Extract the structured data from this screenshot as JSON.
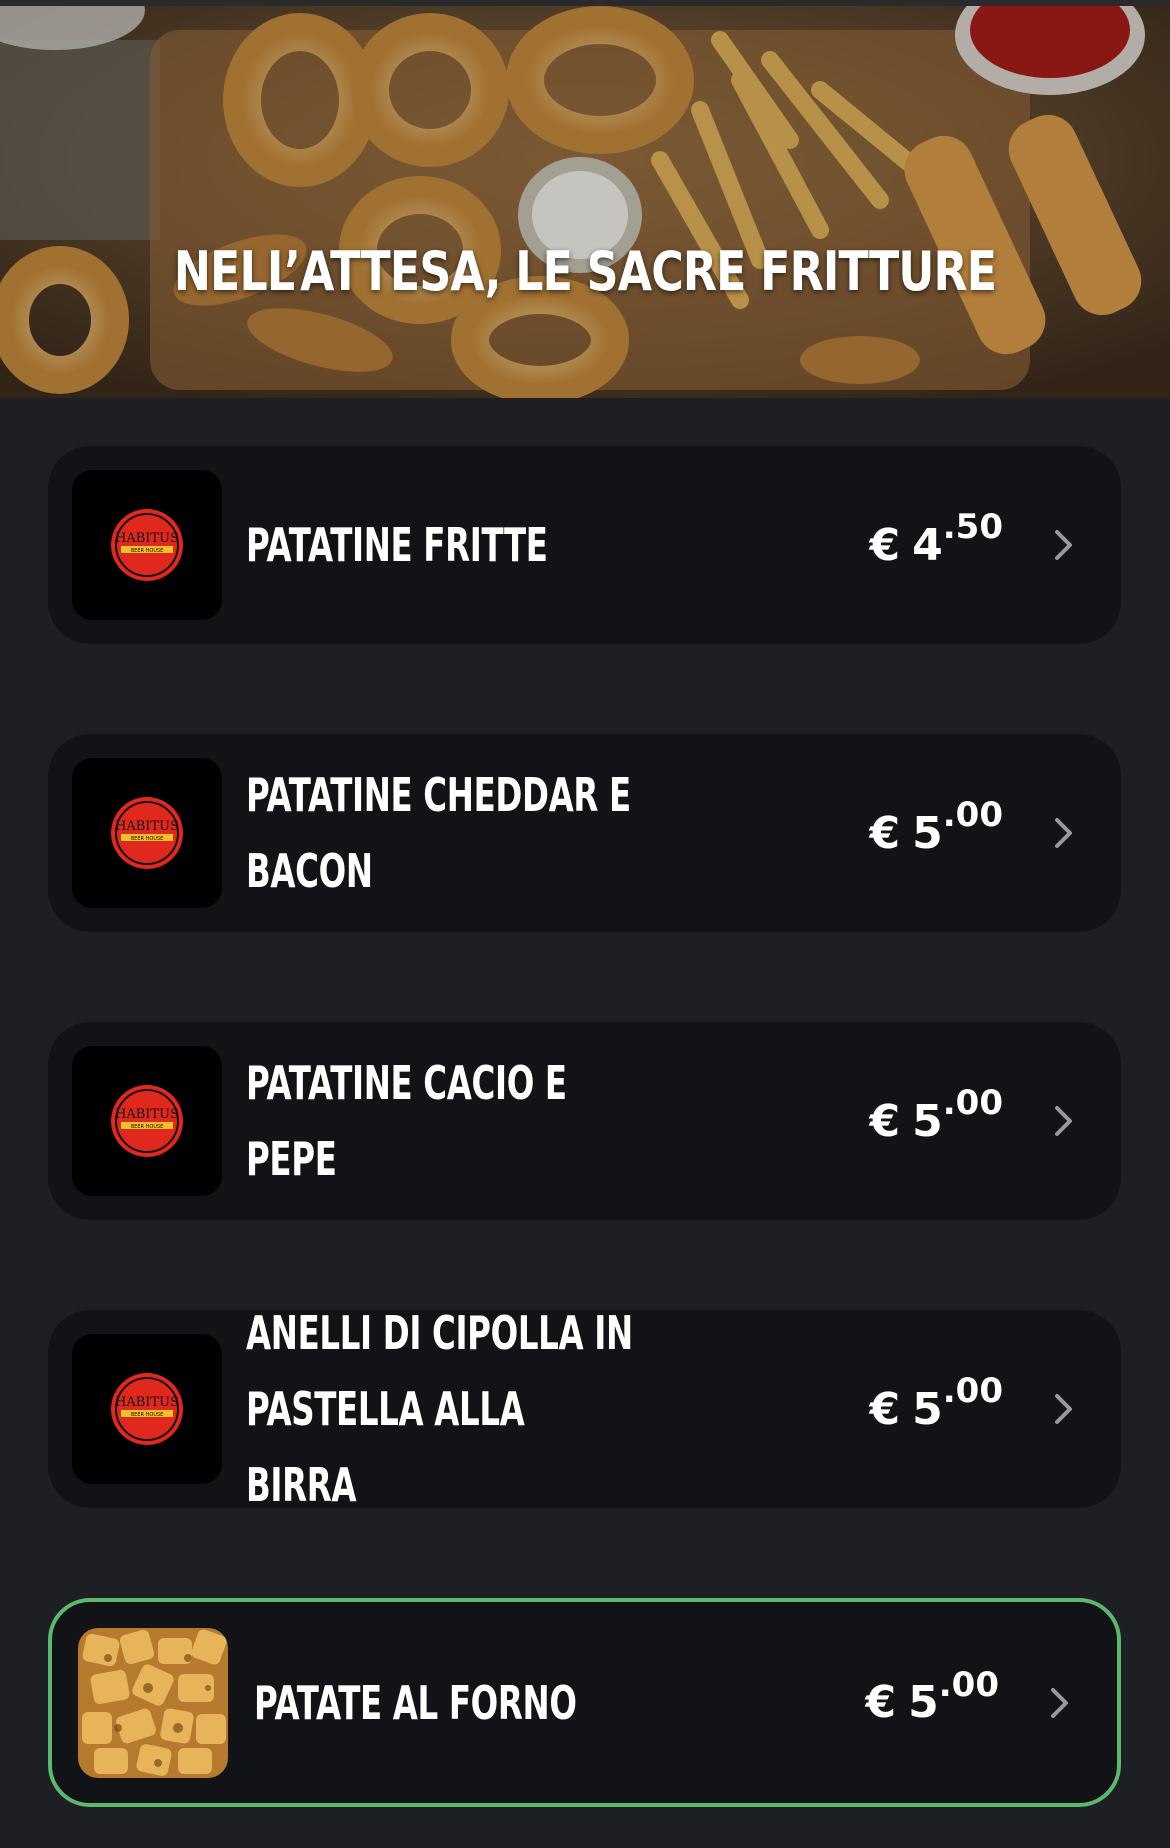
{
  "header": {
    "title": "NELL’ATTESA, LE SACRE FRITTURE"
  },
  "items": [
    {
      "name_line1": "PATATINE FRITTE",
      "name_line2": "",
      "currency": "€",
      "price_int": "4",
      "price_dec": ".50",
      "thumb": "habitus-logo-icon",
      "selected": false
    },
    {
      "name_line1": "PATATINE CHEDDAR E",
      "name_line2": "BACON",
      "currency": "€",
      "price_int": "5",
      "price_dec": ".00",
      "thumb": "habitus-logo-icon",
      "selected": false
    },
    {
      "name_line1": "PATATINE CACIO E PEPE",
      "name_line2": "",
      "currency": "€",
      "price_int": "5",
      "price_dec": ".00",
      "thumb": "habitus-logo-icon",
      "selected": false
    },
    {
      "name_line1": "ANELLI DI CIPOLLA IN",
      "name_line2": "PASTELLA ALLA BIRRA",
      "currency": "€",
      "price_int": "5",
      "price_dec": ".00",
      "thumb": "habitus-logo-icon",
      "selected": false
    },
    {
      "name_line1": "PATATE AL FORNO",
      "name_line2": "",
      "currency": "€",
      "price_int": "5",
      "price_dec": ".00",
      "thumb": "roasted-potatoes-photo",
      "selected": true
    }
  ],
  "colors": {
    "background": "#1e1f24",
    "card": "#121317",
    "selected_border": "#5cb86a",
    "logo_red": "#e0281f"
  },
  "logo_text": {
    "line1": "HABITUS",
    "line2": "BEER HOUSE"
  }
}
